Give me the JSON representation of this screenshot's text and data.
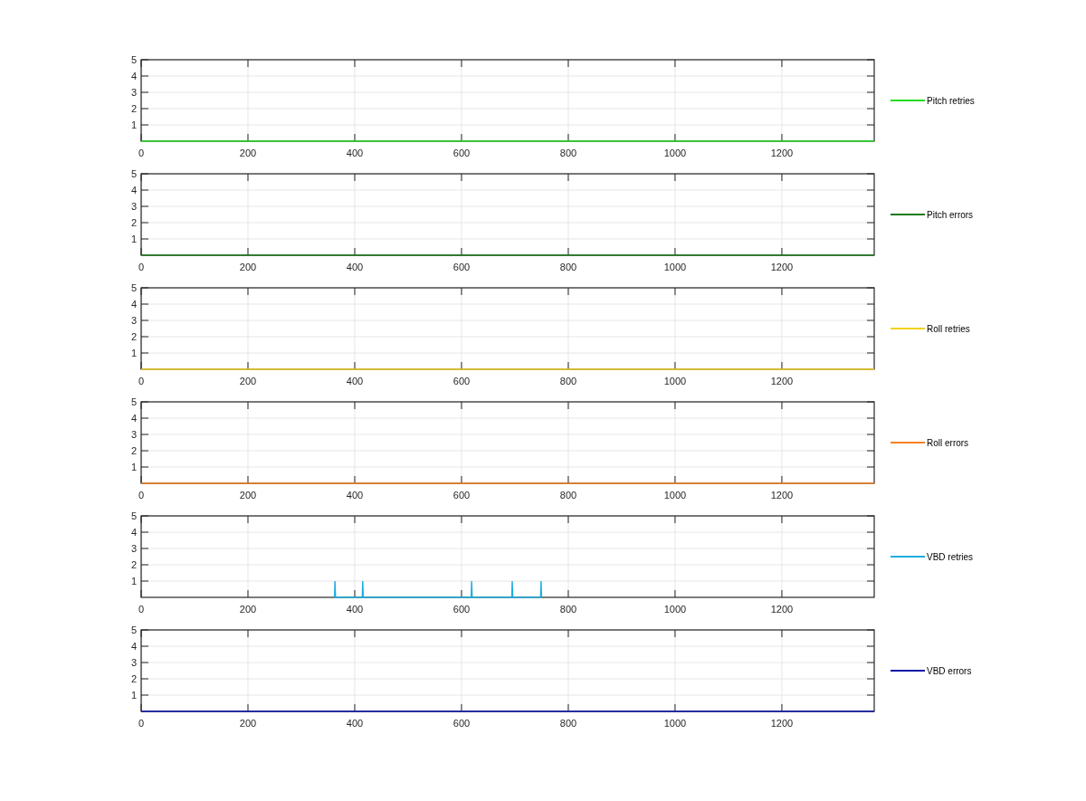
{
  "charts": [
    {
      "chart_data": {
        "type": "line",
        "grid": true,
        "x": [
          0,
          1373
        ],
        "series": [
          {
            "name": "Pitch retries",
            "color": "#22dd22",
            "values": [
              0,
              0
            ]
          }
        ],
        "xlim": [
          0,
          1373
        ],
        "ylim": [
          0,
          5
        ],
        "xticks": [
          0,
          200,
          400,
          600,
          800,
          1000,
          1200
        ],
        "yticks": [
          1,
          2,
          3,
          4,
          5
        ]
      }
    },
    {
      "chart_data": {
        "type": "line",
        "grid": true,
        "x": [
          0,
          1373
        ],
        "series": [
          {
            "name": "Pitch errors",
            "color": "#1a7a1a",
            "values": [
              0,
              0
            ]
          }
        ],
        "xlim": [
          0,
          1373
        ],
        "ylim": [
          0,
          5
        ],
        "xticks": [
          0,
          200,
          400,
          600,
          800,
          1000,
          1200
        ],
        "yticks": [
          1,
          2,
          3,
          4,
          5
        ]
      }
    },
    {
      "chart_data": {
        "type": "line",
        "grid": true,
        "x": [
          0,
          1373
        ],
        "series": [
          {
            "name": "Roll retries",
            "color": "#f2d21c",
            "values": [
              0,
              0
            ]
          }
        ],
        "xlim": [
          0,
          1373
        ],
        "ylim": [
          0,
          5
        ],
        "xticks": [
          0,
          200,
          400,
          600,
          800,
          1000,
          1200
        ],
        "yticks": [
          1,
          2,
          3,
          4,
          5
        ]
      }
    },
    {
      "chart_data": {
        "type": "line",
        "grid": true,
        "x": [
          0,
          1373
        ],
        "series": [
          {
            "name": "Roll errors",
            "color": "#f58220",
            "values": [
              0,
              0
            ]
          }
        ],
        "xlim": [
          0,
          1373
        ],
        "ylim": [
          0,
          5
        ],
        "xticks": [
          0,
          200,
          400,
          600,
          800,
          1000,
          1200
        ],
        "yticks": [
          1,
          2,
          3,
          4,
          5
        ]
      }
    },
    {
      "chart_data": {
        "type": "line",
        "grid": true,
        "x": [
          362,
          363,
          364,
          414,
          415,
          416,
          618,
          619,
          620,
          694,
          695,
          696,
          748,
          749,
          750
        ],
        "series": [
          {
            "name": "VBD retries",
            "color": "#1eaee0",
            "values": [
              0,
              1,
              0,
              0,
              1,
              0,
              0,
              1,
              0,
              0,
              1,
              0,
              0,
              1,
              0
            ]
          }
        ],
        "xlim": [
          0,
          1373
        ],
        "ylim": [
          0,
          5
        ],
        "xticks": [
          0,
          200,
          400,
          600,
          800,
          1000,
          1200
        ],
        "yticks": [
          1,
          2,
          3,
          4,
          5
        ]
      }
    },
    {
      "chart_data": {
        "type": "line",
        "grid": true,
        "x": [
          0,
          1373
        ],
        "series": [
          {
            "name": "VBD errors",
            "color": "#0a14a8",
            "values": [
              0,
              0
            ]
          }
        ],
        "xlim": [
          0,
          1373
        ],
        "ylim": [
          0,
          5
        ],
        "xticks": [
          0,
          200,
          400,
          600,
          800,
          1000,
          1200
        ],
        "yticks": [
          1,
          2,
          3,
          4,
          5
        ]
      }
    }
  ]
}
